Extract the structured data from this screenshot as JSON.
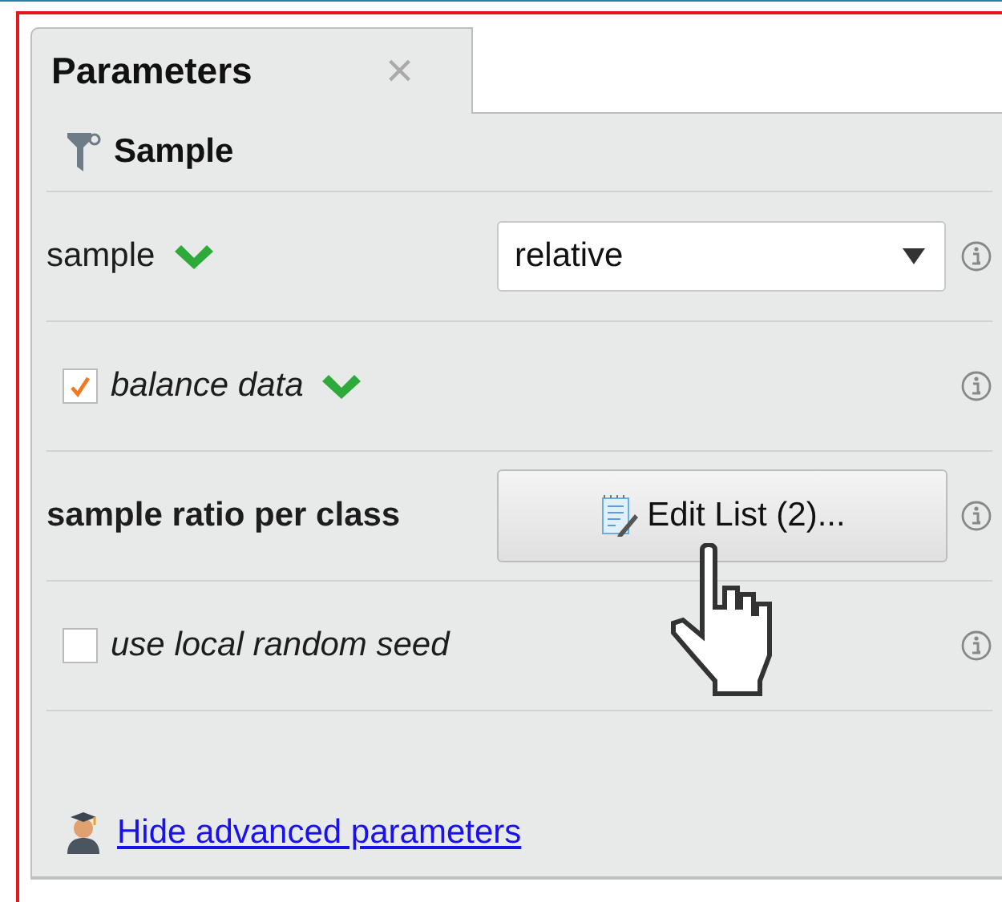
{
  "tab": {
    "title": "Parameters",
    "close": "×"
  },
  "section": {
    "title": "Sample"
  },
  "parameters": [
    {
      "kind": "dropdown",
      "label": "sample",
      "bold": false,
      "valid": true,
      "value": "relative"
    },
    {
      "kind": "checkbox",
      "label": "balance data",
      "checked": true,
      "valid": true
    },
    {
      "kind": "button",
      "label": "sample ratio per class",
      "bold": true,
      "valid": false,
      "button": "Edit List (2)..."
    },
    {
      "kind": "checkbox",
      "label": "use local random seed",
      "checked": false,
      "valid": false
    }
  ],
  "link": "Hide advanced parameters"
}
